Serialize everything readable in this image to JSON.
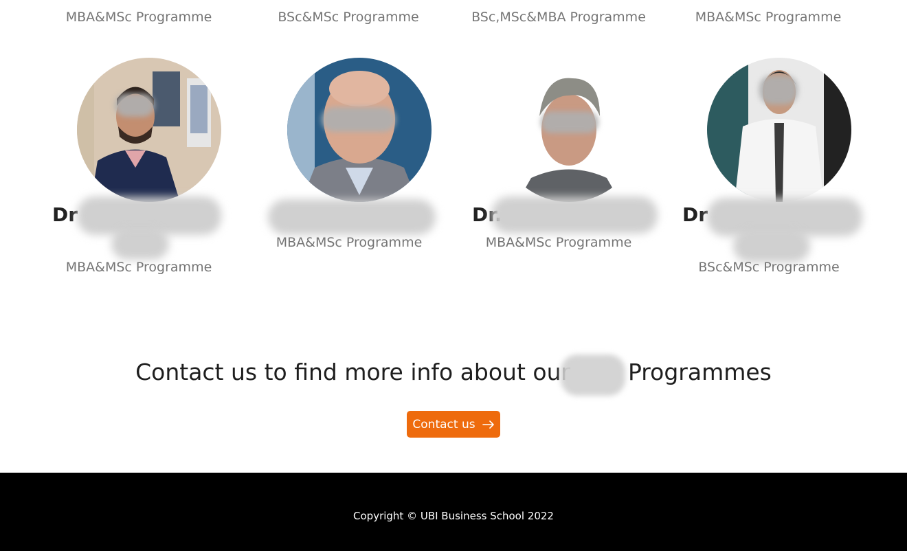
{
  "top_row": {
    "programmes": [
      "MBA&MSc Programme",
      "BSc&MSc Programme",
      "BSc,MSc&MBA Programme",
      "MBA&MSc Programme"
    ]
  },
  "faculty": [
    {
      "name_prefix": "Dr",
      "programme": "MBA&MSc Programme",
      "avatar_icon": "person-photo"
    },
    {
      "name_prefix": "",
      "programme": "MBA&MSc Programme",
      "avatar_icon": "person-photo"
    },
    {
      "name_prefix": "Dr.",
      "programme": "MBA&MSc Programme",
      "avatar_icon": "person-photo"
    },
    {
      "name_prefix": "Dr",
      "programme": "BSc&MSc Programme",
      "avatar_icon": "person-photo"
    }
  ],
  "contact": {
    "heading": "Contact us to find more info about our        Programmes",
    "button_label": "Contact us",
    "button_icon": "arrow-right-icon",
    "accent_color": "#ee6b0d"
  },
  "footer": {
    "copyright": "Copyright © UBI Business School 2022"
  }
}
